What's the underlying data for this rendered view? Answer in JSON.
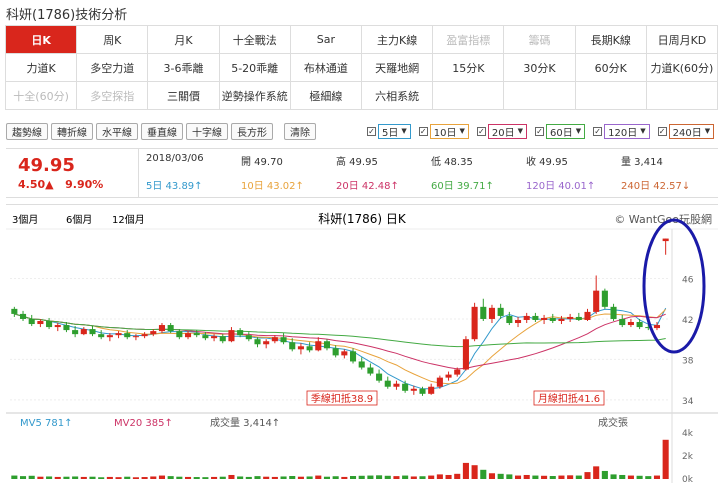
{
  "page_title": "科妍(1786)技術分析",
  "tabs": [
    [
      {
        "label": "日K",
        "active": true
      },
      {
        "label": "周K"
      },
      {
        "label": "月K"
      },
      {
        "label": "十全戰法"
      },
      {
        "label": "Sar"
      },
      {
        "label": "主力K線"
      },
      {
        "label": "盈富指標",
        "dim": true
      },
      {
        "label": "籌碼",
        "dim": true
      },
      {
        "label": "長期K線"
      },
      {
        "label": "日周月KD"
      }
    ],
    [
      {
        "label": "力道K"
      },
      {
        "label": "多空力道"
      },
      {
        "label": "3-6乖離"
      },
      {
        "label": "5-20乖離"
      },
      {
        "label": "布林通道"
      },
      {
        "label": "天羅地網"
      },
      {
        "label": "15分K"
      },
      {
        "label": "30分K"
      },
      {
        "label": "60分K"
      },
      {
        "label": "力道K(60分)"
      }
    ],
    [
      {
        "label": "十全(60分)",
        "dim": true
      },
      {
        "label": "多空探指",
        "dim": true
      },
      {
        "label": "三關價"
      },
      {
        "label": "逆勢操作系統"
      },
      {
        "label": "極細線"
      },
      {
        "label": "六相系統"
      },
      {
        "label": ""
      },
      {
        "label": ""
      },
      {
        "label": ""
      },
      {
        "label": ""
      }
    ]
  ],
  "toolbar": {
    "tools": [
      "趨勢線",
      "轉折線",
      "水平線",
      "垂直線",
      "十字線",
      "長方形",
      "清除"
    ],
    "ma_options": [
      {
        "label": "5日",
        "color": "#3399cc"
      },
      {
        "label": "10日",
        "color": "#e8a33c"
      },
      {
        "label": "20日",
        "color": "#cc3366"
      },
      {
        "label": "60日",
        "color": "#44aa44"
      },
      {
        "label": "120日",
        "color": "#9966cc"
      },
      {
        "label": "240日",
        "color": "#cc6633"
      }
    ]
  },
  "quote": {
    "price": "49.95",
    "change": "4.50▲",
    "change_pct": "9.90%",
    "date": "2018/03/06",
    "open": "開 49.70",
    "high": "高 49.95",
    "low": "低 48.35",
    "close": "收 49.95",
    "volume": "量 3,414",
    "ma5": "5日 43.89↑",
    "ma10": "10日 43.02↑",
    "ma20": "20日 42.48↑",
    "ma60": "60日 39.71↑",
    "ma120": "120日 40.01↑",
    "ma240": "240日 42.57↓"
  },
  "range_buttons": [
    "3個月",
    "6個月",
    "12個月"
  ],
  "chart_title": "科妍(1786) 日K",
  "watermark": "© WantGoo玩股網",
  "annotations": {
    "left": "季線扣抵38.9",
    "right": "月線扣抵41.6"
  },
  "volume_legend": {
    "mv5": "MV5 781↑",
    "mv20": "MV20 385↑",
    "vol": "成交量 3,414↑",
    "unit": "成交張"
  },
  "chart_data": {
    "type": "candlestick",
    "title": "科妍(1786) 日K",
    "price_ylim": [
      33,
      50.5
    ],
    "price_ticks": [
      34,
      38,
      42,
      46
    ],
    "volume_ticks": [
      "0k",
      "2k",
      "4k"
    ],
    "up_color": "#d9261c",
    "down_color": "#2e9e2e",
    "candles": [
      [
        43.0,
        43.2,
        42.2,
        42.5
      ],
      [
        42.5,
        42.8,
        41.8,
        42.0
      ],
      [
        42.0,
        42.4,
        41.3,
        41.5
      ],
      [
        41.5,
        42.0,
        41.2,
        41.8
      ],
      [
        41.8,
        42.1,
        41.0,
        41.2
      ],
      [
        41.2,
        41.6,
        40.8,
        41.4
      ],
      [
        41.4,
        41.7,
        40.7,
        40.9
      ],
      [
        40.9,
        41.3,
        40.2,
        40.5
      ],
      [
        40.5,
        41.2,
        40.4,
        41.0
      ],
      [
        41.0,
        41.3,
        40.3,
        40.5
      ],
      [
        40.5,
        40.9,
        40.0,
        40.2
      ],
      [
        40.2,
        40.6,
        39.8,
        40.4
      ],
      [
        40.4,
        40.8,
        40.1,
        40.6
      ],
      [
        40.6,
        40.9,
        40.0,
        40.2
      ],
      [
        40.2,
        40.5,
        39.9,
        40.3
      ],
      [
        40.3,
        40.7,
        40.1,
        40.5
      ],
      [
        40.5,
        41.0,
        40.3,
        40.8
      ],
      [
        40.8,
        41.6,
        40.6,
        41.4
      ],
      [
        41.4,
        41.6,
        40.6,
        40.8
      ],
      [
        40.8,
        41.0,
        40.0,
        40.2
      ],
      [
        40.2,
        40.8,
        40.0,
        40.6
      ],
      [
        40.6,
        40.9,
        40.2,
        40.4
      ],
      [
        40.4,
        40.7,
        39.9,
        40.1
      ],
      [
        40.1,
        40.5,
        39.8,
        40.3
      ],
      [
        40.3,
        40.5,
        39.6,
        39.8
      ],
      [
        39.8,
        41.2,
        39.7,
        40.9
      ],
      [
        40.9,
        41.1,
        40.2,
        40.4
      ],
      [
        40.4,
        40.7,
        39.8,
        40.0
      ],
      [
        40.0,
        40.2,
        39.2,
        39.5
      ],
      [
        39.5,
        40.0,
        39.1,
        39.8
      ],
      [
        39.8,
        40.4,
        39.6,
        40.2
      ],
      [
        40.2,
        40.6,
        39.5,
        39.7
      ],
      [
        39.7,
        40.1,
        38.8,
        39.0
      ],
      [
        39.0,
        39.6,
        38.5,
        39.3
      ],
      [
        39.3,
        39.7,
        38.7,
        38.9
      ],
      [
        38.9,
        40.2,
        38.8,
        39.8
      ],
      [
        39.8,
        40.0,
        38.9,
        39.1
      ],
      [
        39.1,
        39.4,
        38.2,
        38.4
      ],
      [
        38.4,
        39.0,
        38.1,
        38.8
      ],
      [
        38.8,
        39.1,
        37.6,
        37.8
      ],
      [
        37.8,
        38.2,
        37.0,
        37.2
      ],
      [
        37.2,
        37.6,
        36.4,
        36.6
      ],
      [
        36.6,
        37.0,
        35.7,
        35.9
      ],
      [
        35.9,
        36.3,
        35.1,
        35.3
      ],
      [
        35.3,
        35.9,
        35.0,
        35.6
      ],
      [
        35.6,
        35.9,
        34.7,
        34.9
      ],
      [
        34.9,
        35.4,
        34.5,
        35.1
      ],
      [
        35.1,
        35.3,
        34.4,
        34.6
      ],
      [
        34.6,
        35.6,
        34.5,
        35.3
      ],
      [
        35.3,
        36.4,
        35.1,
        36.2
      ],
      [
        36.2,
        36.8,
        35.9,
        36.5
      ],
      [
        36.5,
        37.2,
        36.3,
        37.0
      ],
      [
        37.0,
        40.3,
        36.9,
        40.0
      ],
      [
        40.0,
        43.6,
        39.8,
        43.2
      ],
      [
        43.2,
        44.0,
        41.8,
        42.0
      ],
      [
        42.0,
        43.4,
        41.6,
        43.1
      ],
      [
        43.1,
        43.5,
        42.0,
        42.3
      ],
      [
        42.3,
        42.7,
        41.4,
        41.6
      ],
      [
        41.6,
        42.2,
        41.2,
        41.9
      ],
      [
        41.9,
        42.6,
        41.6,
        42.3
      ],
      [
        42.3,
        42.6,
        41.7,
        41.9
      ],
      [
        41.9,
        42.4,
        41.5,
        42.1
      ],
      [
        42.1,
        42.5,
        41.6,
        41.8
      ],
      [
        41.8,
        42.3,
        41.5,
        42.0
      ],
      [
        42.0,
        42.5,
        41.7,
        42.2
      ],
      [
        42.2,
        42.6,
        41.8,
        41.9
      ],
      [
        41.9,
        43.0,
        41.8,
        42.7
      ],
      [
        42.7,
        46.3,
        42.5,
        44.8
      ],
      [
        44.8,
        45.0,
        43.0,
        43.2
      ],
      [
        43.2,
        43.5,
        41.8,
        42.0
      ],
      [
        42.0,
        42.4,
        41.2,
        41.4
      ],
      [
        41.4,
        42.0,
        41.2,
        41.7
      ],
      [
        41.7,
        42.0,
        41.0,
        41.2
      ],
      [
        41.2,
        41.5,
        40.9,
        41.1
      ],
      [
        41.1,
        41.7,
        40.9,
        41.4
      ],
      [
        49.7,
        49.95,
        48.35,
        49.95
      ]
    ],
    "volumes": [
      0.3,
      0.25,
      0.28,
      0.2,
      0.22,
      0.18,
      0.2,
      0.22,
      0.18,
      0.2,
      0.15,
      0.18,
      0.16,
      0.2,
      0.15,
      0.17,
      0.22,
      0.3,
      0.25,
      0.2,
      0.18,
      0.17,
      0.16,
      0.18,
      0.2,
      0.35,
      0.22,
      0.18,
      0.25,
      0.2,
      0.18,
      0.22,
      0.26,
      0.2,
      0.22,
      0.3,
      0.2,
      0.24,
      0.18,
      0.26,
      0.28,
      0.3,
      0.32,
      0.28,
      0.25,
      0.3,
      0.22,
      0.24,
      0.3,
      0.4,
      0.35,
      0.45,
      1.4,
      1.2,
      0.8,
      0.5,
      0.45,
      0.4,
      0.3,
      0.35,
      0.3,
      0.28,
      0.26,
      0.3,
      0.32,
      0.3,
      0.6,
      1.1,
      0.7,
      0.4,
      0.35,
      0.3,
      0.28,
      0.25,
      0.3,
      3.41
    ]
  }
}
